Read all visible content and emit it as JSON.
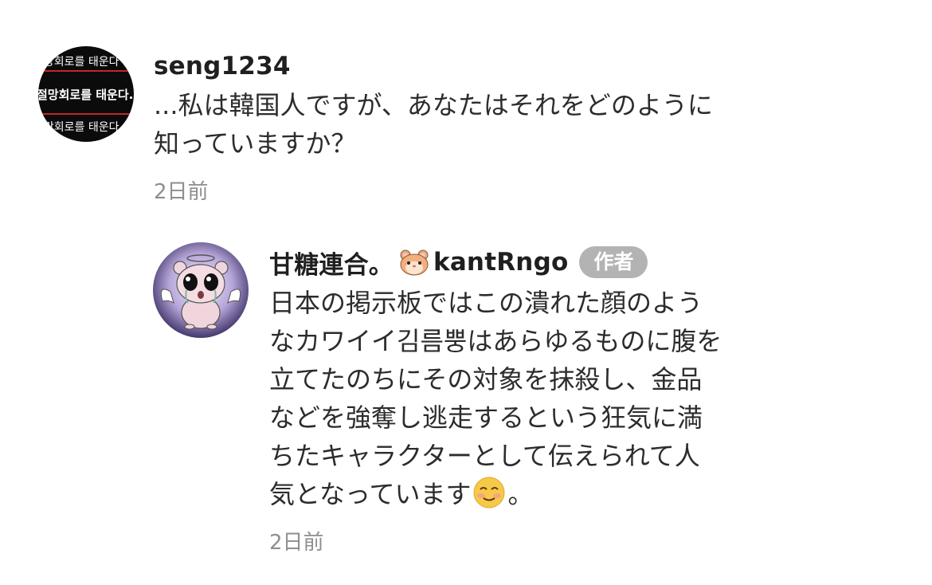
{
  "comments": [
    {
      "username": "seng1234",
      "avatar_text": [
        "절망회로를 태운다",
        "절망회로를 태운다.",
        "절망회로를 태운다"
      ],
      "text_lines": [
        "...私は韓国人ですが、あなたはそれをどのように",
        "知っていますか？"
      ],
      "time": "2日前"
    },
    {
      "username": "甘糖連合。",
      "username_suffix": "kantRngo",
      "username_emoji": "hamster-emoji",
      "badge": "作者",
      "avatar_icon": "hamster-angel-avatar",
      "text_lines": [
        "日本の掲示板ではこの潰れた顔のよう",
        "なカワイイ김름뿡はあらゆるものに腹を",
        "立てたのちにその対象を抹殺し、金品",
        "などを強奪し逃走するという狂気に満",
        "ちたキャラクターとして伝えられて人",
        "気となっています"
      ],
      "text_end_emoji": "smiling-face-emoji",
      "text_end": "。",
      "time": "2日前"
    }
  ],
  "colors": {
    "text": "#2c2c2c",
    "username": "#1f1f1f",
    "time": "#8e8e8e",
    "badge_bg": "#b3b3b3",
    "badge_text": "#ffffff"
  }
}
